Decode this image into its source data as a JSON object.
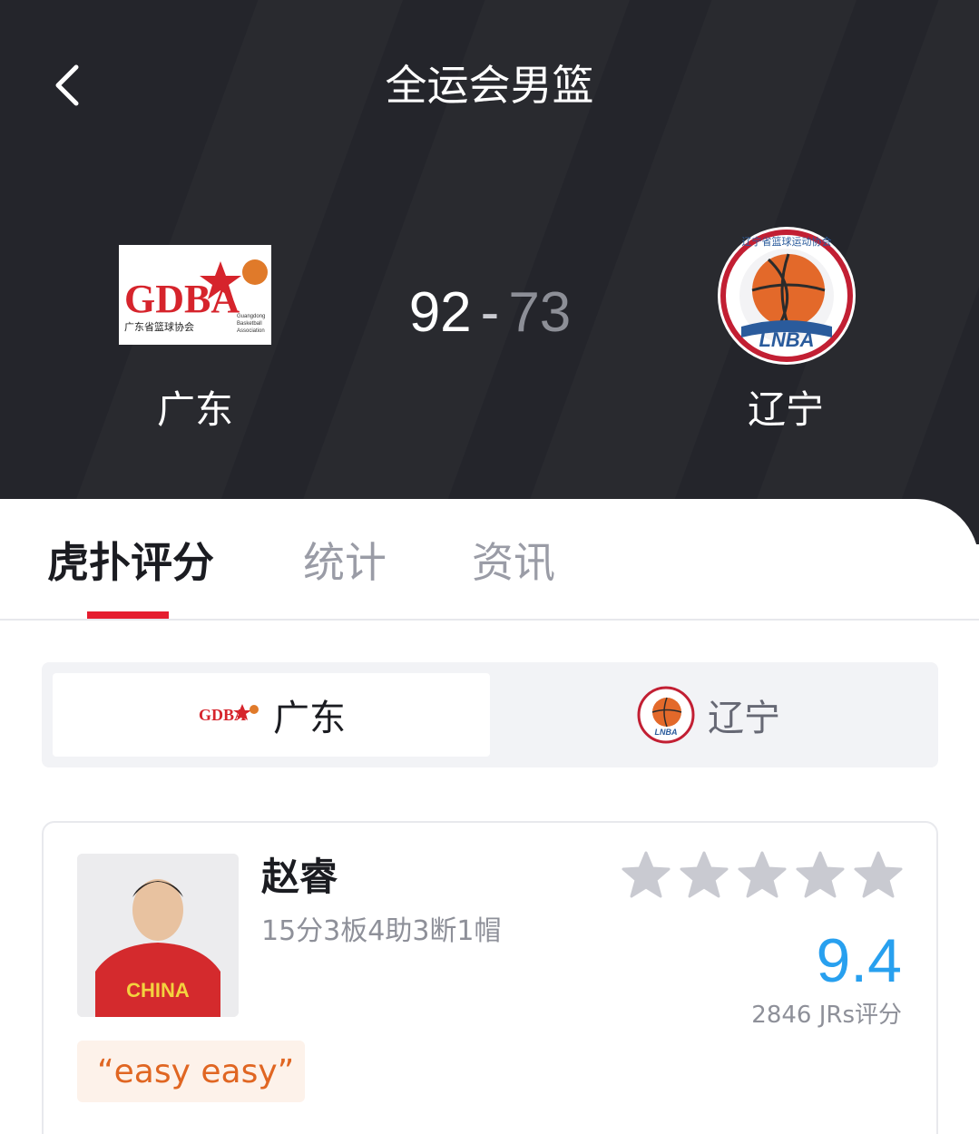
{
  "header": {
    "title": "全运会男篮",
    "bg_color": "#24252b"
  },
  "match": {
    "home": {
      "name": "广东",
      "score": "92",
      "logo_text": "GDBA",
      "logo_sub": "广东省篮球协会",
      "logo_sub_en": [
        "Guangdong",
        "Basketball",
        "Association"
      ]
    },
    "away": {
      "name": "辽宁",
      "score": "73",
      "logo_ring_text": "辽宁省篮球运动协会",
      "logo_text": "LNBA"
    },
    "separator": "-"
  },
  "tabs": [
    {
      "label": "虎扑评分",
      "active": true
    },
    {
      "label": "统计",
      "active": false
    },
    {
      "label": "资讯",
      "active": false
    }
  ],
  "accent_color": "#e51d2f",
  "team_switch": {
    "home_label": "广东",
    "away_label": "辽宁",
    "selected": "home"
  },
  "player": {
    "name": "赵睿",
    "stats": "15分3板4助3断1帽",
    "photo_jersey_text": "CHINA",
    "stars_filled": 0,
    "stars_total": 5,
    "rating": "9.4",
    "rating_color": "#28a0ef",
    "rating_count": "2846 JRs评分",
    "top_comment": "“easy easy”"
  },
  "icons": {
    "back": "chevron-left-icon",
    "star": "star-icon"
  }
}
